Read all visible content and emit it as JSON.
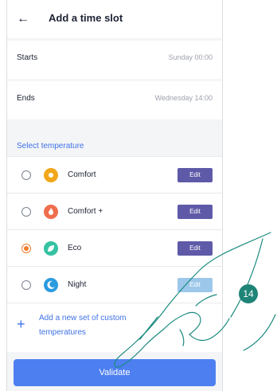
{
  "header": {
    "back_icon": "arrow-left-icon",
    "title": "Add a time slot"
  },
  "times": [
    {
      "label": "Starts",
      "value": "Sunday 00:00"
    },
    {
      "label": "Ends",
      "value": "Wednesday 14:00"
    }
  ],
  "section_title": "Select temperature",
  "options": [
    {
      "label": "Comfort",
      "icon": "sun-icon",
      "color": "#f2a71b",
      "edit": "Edit",
      "selected": false,
      "edit_color": "#5e5aa8"
    },
    {
      "label": "Comfort +",
      "icon": "flame-icon",
      "color": "#ef6e4d",
      "edit": "Edit",
      "selected": false,
      "edit_color": "#5e5aa8"
    },
    {
      "label": "Eco",
      "icon": "leaf-icon",
      "color": "#35c2a2",
      "edit": "Edit",
      "selected": true,
      "edit_color": "#5e5aa8"
    },
    {
      "label": "Night",
      "icon": "moon-icon",
      "color": "#2b9be0",
      "edit": "Edit",
      "selected": false,
      "edit_color": "#9cc7ea"
    }
  ],
  "add_label": "Add a new set of custom temperatures",
  "add_icon": "plus-icon",
  "validate_label": "Validate",
  "callout": "14",
  "colors": {
    "accent": "#3f72e6",
    "button": "#4d7ff1",
    "selected_radio": "#ef7d2a",
    "callout": "#1f8478"
  }
}
